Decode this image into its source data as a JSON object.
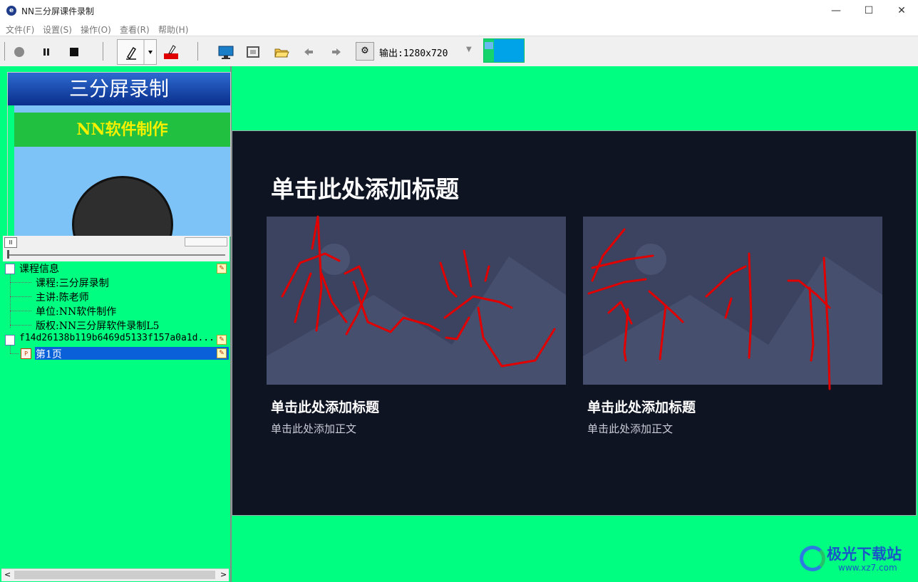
{
  "window": {
    "title": "NN三分屏课件录制",
    "minimize_glyph": "—",
    "maximize_glyph": "☐",
    "close_glyph": "✕"
  },
  "menu": [
    "文件(F)",
    "设置(S)",
    "操作(O)",
    "查看(R)",
    "帮助(H)"
  ],
  "toolbar": {
    "record_icon": "record-icon",
    "pause_icon": "pause-icon",
    "stop_icon": "stop-icon",
    "output_label": "输出:1280x720",
    "colors": {
      "pen_red": "#e00000",
      "layout_blue": "#00a3e8",
      "layout_green": "#17d36b"
    }
  },
  "preview": {
    "banner": "三分屏录制",
    "subtitle": "NN软件制作",
    "pause_glyph": "II"
  },
  "tree": {
    "course_info": "课程信息",
    "course": "课程:三分屏录制",
    "lecturer": "主讲:陈老师",
    "org": "单位:NN软件制作",
    "copyright": "版权:NN三分屏软件录制L5",
    "file": "f14d26138b119b6469d5133f157a0a1d...",
    "page": "第1页"
  },
  "slide": {
    "title": "单击此处添加标题",
    "cards": [
      {
        "title": "单击此处添加标题",
        "body": "单击此处添加正文"
      },
      {
        "title": "单击此处添加标题",
        "body": "单击此处添加正文"
      }
    ],
    "background": "#0f1423",
    "ink_color": "#e00000"
  },
  "watermark": {
    "text": "极光下载站",
    "url": "www.xz7.com"
  }
}
